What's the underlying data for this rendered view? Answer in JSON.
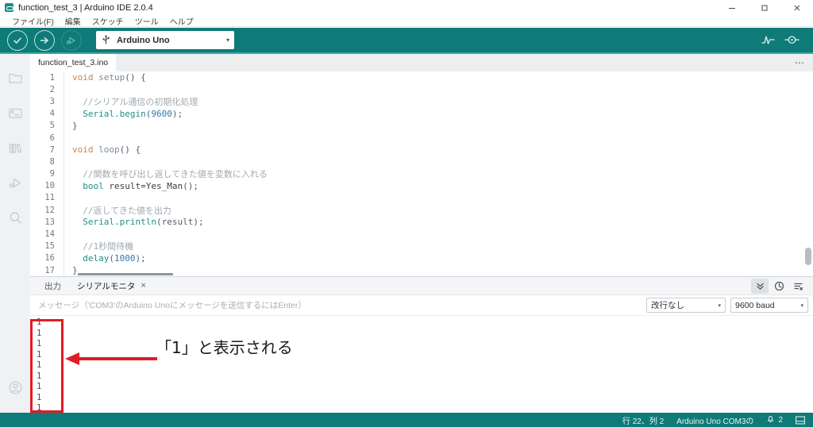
{
  "window": {
    "title": "function_test_3 | Arduino IDE 2.0.4",
    "app_icon": "arduino-icon",
    "minimize_label": "–",
    "maximize_label": "□",
    "close_label": "×"
  },
  "menubar": {
    "items": [
      {
        "label": "ファイル(F)",
        "name": "menu-file"
      },
      {
        "label": "編集",
        "name": "menu-edit"
      },
      {
        "label": "スケッチ",
        "name": "menu-sketch"
      },
      {
        "label": "ツール",
        "name": "menu-tools"
      },
      {
        "label": "ヘルプ",
        "name": "menu-help"
      }
    ]
  },
  "toolbar": {
    "verify_label": "verify-icon",
    "upload_label": "upload-icon",
    "debug_label": "debug-icon",
    "board": "Arduino Uno",
    "board_caret": "▾",
    "serial_plotter_label": "serial-plotter-icon",
    "serial_monitor_label": "serial-monitor-icon",
    "accent_color": "#0e7b78"
  },
  "activitybar": {
    "items": [
      {
        "name": "sketchbook-icon",
        "label": "スケッチブック"
      },
      {
        "name": "boards-manager-icon",
        "label": "ボードマネージャ"
      },
      {
        "name": "library-manager-icon",
        "label": "ライブラリマネージャ"
      },
      {
        "name": "debug-icon",
        "label": "デバッグ"
      },
      {
        "name": "search-icon",
        "label": "検索"
      }
    ],
    "account_label": "account-icon"
  },
  "editor": {
    "tab_name": "function_test_3.ino",
    "overflow_label": "⋯",
    "lines": [
      {
        "num": "1",
        "tokens": [
          {
            "t": "void",
            "c": "t-kw"
          },
          {
            "t": " ",
            "c": "t-ident"
          },
          {
            "t": "setup",
            "c": "t-fn"
          },
          {
            "t": "() {",
            "c": "t-punc"
          }
        ]
      },
      {
        "num": "2",
        "tokens": []
      },
      {
        "num": "3",
        "tokens": [
          {
            "t": "  //シリアル通信の初期化処理",
            "c": "t-cmt"
          }
        ]
      },
      {
        "num": "4",
        "tokens": [
          {
            "t": "  ",
            "c": "t-ident"
          },
          {
            "t": "Serial.begin",
            "c": "t-call"
          },
          {
            "t": "(",
            "c": "t-punc"
          },
          {
            "t": "9600",
            "c": "t-num"
          },
          {
            "t": ");",
            "c": "t-punc"
          }
        ]
      },
      {
        "num": "5",
        "tokens": [
          {
            "t": "}",
            "c": "t-punc"
          }
        ]
      },
      {
        "num": "6",
        "tokens": []
      },
      {
        "num": "7",
        "tokens": [
          {
            "t": "void",
            "c": "t-kw"
          },
          {
            "t": " ",
            "c": "t-ident"
          },
          {
            "t": "loop",
            "c": "t-fn"
          },
          {
            "t": "() {",
            "c": "t-punc"
          }
        ]
      },
      {
        "num": "8",
        "tokens": []
      },
      {
        "num": "9",
        "tokens": [
          {
            "t": "  //関数を呼び出し返してきた値を変数に入れる",
            "c": "t-cmt"
          }
        ]
      },
      {
        "num": "10",
        "tokens": [
          {
            "t": "  ",
            "c": "t-ident"
          },
          {
            "t": "bool",
            "c": "t-type"
          },
          {
            "t": " result=",
            "c": "t-ident"
          },
          {
            "t": "Yes_Man",
            "c": "t-ident"
          },
          {
            "t": "();",
            "c": "t-punc"
          }
        ]
      },
      {
        "num": "11",
        "tokens": []
      },
      {
        "num": "12",
        "tokens": [
          {
            "t": "  //返してきた値を出力",
            "c": "t-cmt"
          }
        ]
      },
      {
        "num": "13",
        "tokens": [
          {
            "t": "  ",
            "c": "t-ident"
          },
          {
            "t": "Serial.println",
            "c": "t-call"
          },
          {
            "t": "(result);",
            "c": "t-punc"
          }
        ]
      },
      {
        "num": "14",
        "tokens": []
      },
      {
        "num": "15",
        "tokens": [
          {
            "t": "  //1秒間待機",
            "c": "t-cmt"
          }
        ]
      },
      {
        "num": "16",
        "tokens": [
          {
            "t": "  ",
            "c": "t-ident"
          },
          {
            "t": "delay",
            "c": "t-call"
          },
          {
            "t": "(",
            "c": "t-punc"
          },
          {
            "t": "1000",
            "c": "t-num"
          },
          {
            "t": ");",
            "c": "t-punc"
          }
        ]
      },
      {
        "num": "17",
        "tokens": [
          {
            "t": "}",
            "c": "t-punc"
          }
        ]
      }
    ]
  },
  "panel": {
    "tab_output": "出力",
    "tab_serial_monitor": "シリアルモニタ",
    "tab_close": "×",
    "tools": [
      {
        "name": "autoscroll-icon",
        "glyph": "»"
      },
      {
        "name": "timestamp-icon",
        "glyph": "◷"
      },
      {
        "name": "clear-output-icon",
        "glyph": "≡"
      }
    ],
    "message_placeholder": "メッセージ（'COM3'のArduino Unoにメッセージを送信するにはEnter）",
    "line_ending": "改行なし",
    "baud_rate": "9600 baud",
    "caret": "▾",
    "output_lines": [
      "1",
      "1",
      "1",
      "1",
      "1",
      "1",
      "1",
      "1",
      "1"
    ]
  },
  "annotation": {
    "text": "「1」と表示される",
    "color": "#e31b23"
  },
  "statusbar": {
    "cursor_position": "行 22、列 2",
    "board_port": "Arduino Uno COM3の",
    "notification_count": "2",
    "notification_icon": "bell-icon",
    "layout_icon": "panel-layout-icon"
  }
}
